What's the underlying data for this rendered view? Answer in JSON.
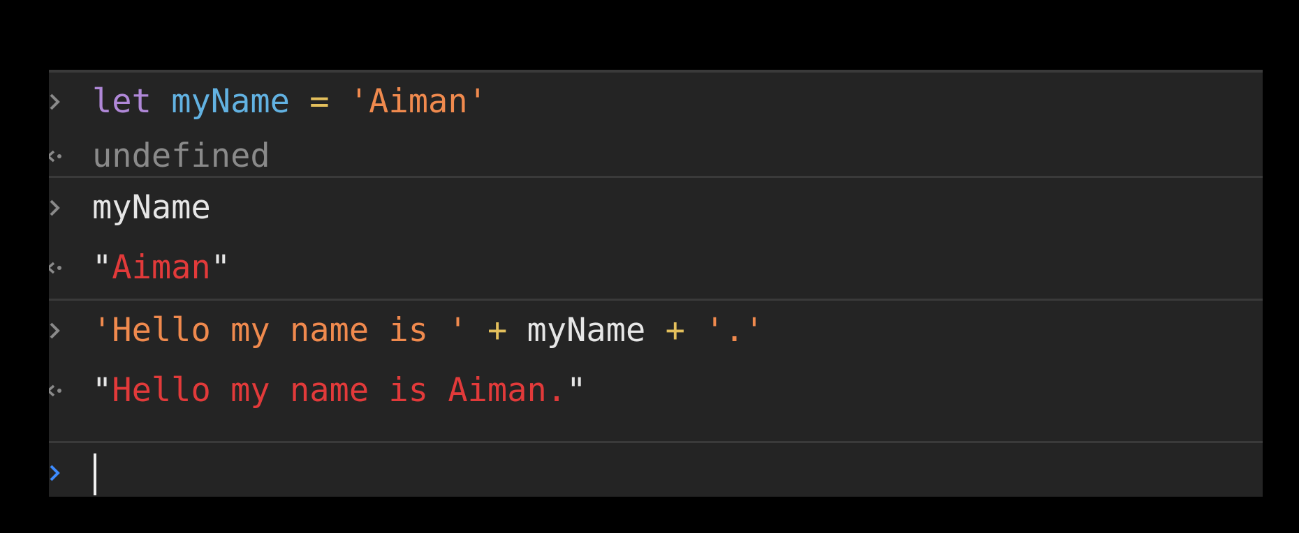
{
  "console": {
    "entries": [
      {
        "input": {
          "keyword": "let",
          "sp1": " ",
          "variable": "myName",
          "sp2": " ",
          "operator": "=",
          "sp3": " ",
          "string": "'Aiman'"
        },
        "output": {
          "value": "undefined"
        }
      },
      {
        "input": {
          "identifier": "myName"
        },
        "output": {
          "quote_open": "\"",
          "value": "Aiman",
          "quote_close": "\""
        }
      },
      {
        "input": {
          "string1": "'Hello my name is '",
          "sp1": " ",
          "op1": "+",
          "sp2": " ",
          "identifier": "myName",
          "sp3": " ",
          "op2": "+",
          "sp4": " ",
          "string2": "'.'"
        },
        "output": {
          "quote_open": "\"",
          "value": "Hello my name is Aiman.",
          "quote_close": "\""
        }
      }
    ],
    "prompt": {
      "value": ""
    }
  },
  "colors": {
    "background": "#000000",
    "panel": "#242424",
    "separator": "#3a3a3a",
    "keyword": "#b088d8",
    "variable": "#62b2e2",
    "operator": "#e4c05c",
    "string": "#f08a4e",
    "result_string": "#e23a3a",
    "undefined": "#8a8a8a",
    "prompt_active": "#3d8bff"
  },
  "icons": {
    "input_marker": "chevron-right-icon",
    "output_marker": "return-arrow-icon",
    "prompt_marker": "chevron-right-icon"
  }
}
